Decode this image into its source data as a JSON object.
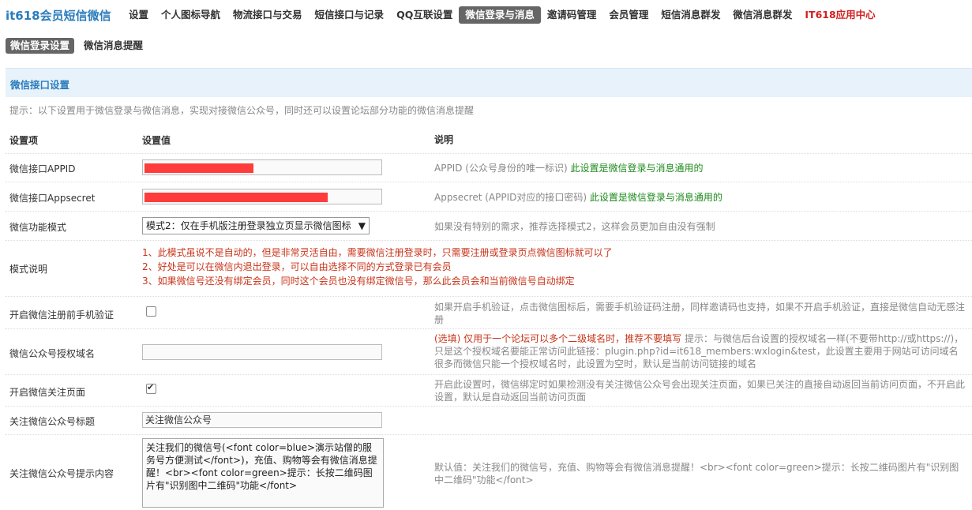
{
  "brand": "it618会员短信微信",
  "nav": [
    {
      "label": "设置"
    },
    {
      "label": "个人图标导航"
    },
    {
      "label": "物流接口与交易"
    },
    {
      "label": "短信接口与记录"
    },
    {
      "label": "QQ互联设置"
    },
    {
      "label": "微信登录与消息"
    },
    {
      "label": "邀请码管理"
    },
    {
      "label": "会员管理"
    },
    {
      "label": "短信消息群发"
    },
    {
      "label": "微信消息群发"
    },
    {
      "label": "IT618应用中心"
    }
  ],
  "subnav": [
    {
      "label": "微信登录设置"
    },
    {
      "label": "微信消息提醒"
    }
  ],
  "section_title": "微信接口设置",
  "tip": "提示：以下设置用于微信登录与微信消息，实现对接微信公众号，同时还可以设置论坛部分功能的微信消息提醒",
  "headers": {
    "c1": "设置项",
    "c2": "设置值",
    "c3": "说明"
  },
  "rows": {
    "appid": {
      "label": "微信接口APPID",
      "desc": "APPID (公众号身份的唯一标识)",
      "desc_green": "此设置是微信登录与消息通用的"
    },
    "secret": {
      "label": "微信接口Appsecret",
      "desc": "Appsecret (APPID对应的接口密码)",
      "desc_green": "此设置是微信登录与消息通用的"
    },
    "mode": {
      "label": "微信功能模式",
      "value": "模式2：仅在手机版注册登录独立页显示微信图标",
      "desc": "如果没有特别的需求，推荐选择模式2，这样会员更加自由没有强制"
    },
    "mode_note": {
      "label": "模式说明",
      "lines": [
        "1、此模式虽说不是自动的，但是非常灵活自由，需要微信注册登录时，只需要注册或登录页点微信图标就可以了",
        "2、好处是可以在微信内退出登录，可以自由选择不同的方式登录已有会员",
        "3、如果微信号还没有绑定会员，同时这个会员也没有绑定微信号，那么此会员会和当前微信号自动绑定"
      ]
    },
    "phone_verify": {
      "label": "开启微信注册前手机验证",
      "checked": false,
      "desc": "如果开启手机验证，点击微信图标后，需要手机验证码注册，同样邀请码也支持，如果不开启手机验证，直接是微信自动无感注册"
    },
    "domain": {
      "label": "微信公众号授权域名",
      "value": "",
      "desc_red": "(选填) 仅用于一个论坛可以多个二级域名时，推荐不要填写",
      "desc": "提示：与微信后台设置的授权域名一样(不要带http://或https://)，只是这个授权域名要能正常访问此链接：plugin.php?id=it618_members:wxlogin&test，此设置主要用于网站可访问域名很多而微信只能一个授权域名时，此设置为空时，默认是当前访问链接的域名"
    },
    "follow_page": {
      "label": "开启微信关注页面",
      "checked": true,
      "desc": "开启此设置时，微信绑定时如果检测没有关注微信公众号会出现关注页面，如果已关注的直接自动返回当前访问页面，不开启此设置，默认是自动返回当前访问页面"
    },
    "follow_title": {
      "label": "关注微信公众号标题",
      "value": "关注微信公众号"
    },
    "follow_content": {
      "label": "关注微信公众号提示内容",
      "value": "关注我们的微信号(<font color=blue>演示站僧的服务号方便测试</font>)，充值、购物等会有微信消息提醒！<br><font color=green>提示：长按二维码图片有\"识别图中二维码\"功能</font>",
      "desc": "默认值：关注我们的微信号，充值、购物等会有微信消息提醒！<br><font color=green>提示：长按二维码图片有\"识别图中二维码\"功能</font>"
    }
  },
  "colors": {
    "accent": "#2b7dbc",
    "active_tab": "#666666",
    "redacted": "#ff3b3b",
    "green": "#1d8a1d",
    "red_note": "#c8341a"
  }
}
